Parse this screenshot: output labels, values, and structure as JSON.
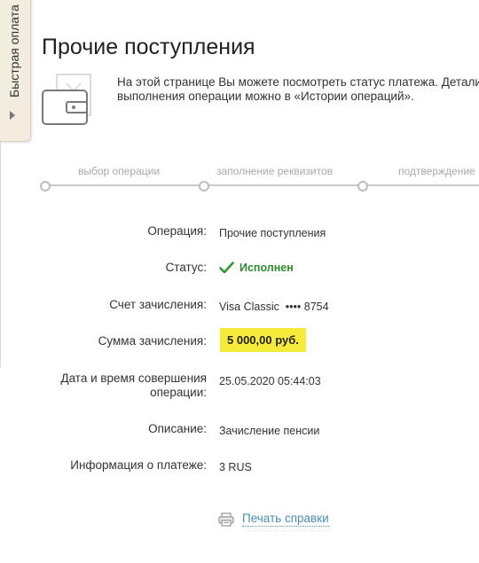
{
  "side_tab": {
    "label": "Быстрая оплата"
  },
  "page": {
    "title": "Прочие поступления",
    "intro_line1": "На этой странице Вы можете посмотреть статус платежа. Детали",
    "intro_line2": "выполнения операции можно в «Истории операций»."
  },
  "steps": [
    "выбор операции",
    "заполнение реквизитов",
    "подтверждение"
  ],
  "details": {
    "operation_label": "Операция:",
    "operation_value": "Прочие поступления",
    "status_label": "Статус:",
    "status_value": "Исполнен",
    "account_label": "Счет зачисления:",
    "account_value": "Visa Classic  •••• 8754",
    "amount_label": "Сумма зачисления:",
    "amount_value": "5 000,00 руб.",
    "datetime_label_line1": "Дата и время совершения",
    "datetime_label_line2": "операции:",
    "datetime_value": "25.05.2020 05:44:03",
    "description_label": "Описание:",
    "description_value": "Зачисление пенсии",
    "payment_info_label": "Информация о платеже:",
    "payment_info_value": "3 RUS"
  },
  "actions": {
    "print_label": "Печать справки"
  },
  "colors": {
    "status_green": "#2e8b2e",
    "amount_highlight": "#f6ea3a",
    "link_blue": "#4a8fb8",
    "side_tab_bg": "#f3ede0"
  },
  "icons": {
    "wallet": "wallet-icon",
    "check": "check-icon",
    "printer": "printer-icon",
    "arrow": "arrow-right-icon"
  }
}
